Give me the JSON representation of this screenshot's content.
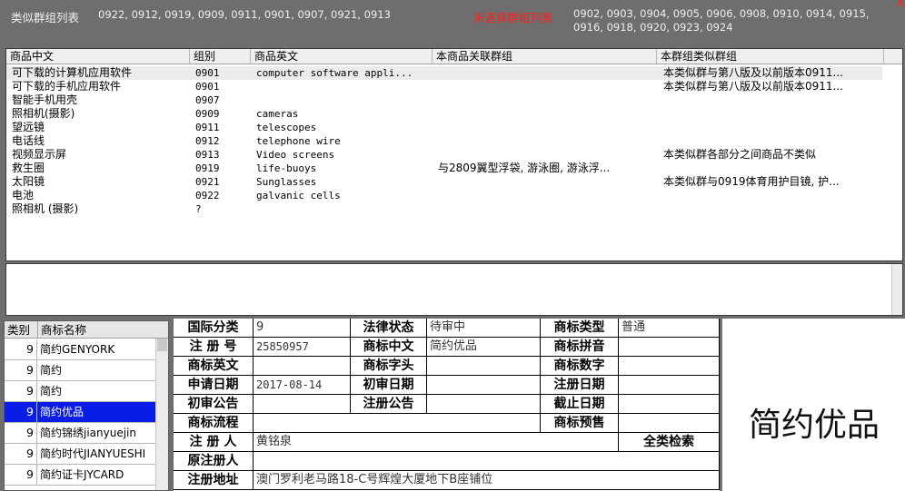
{
  "header": {
    "similar_groups_label": "类似群组列表",
    "similar_groups": "0922, 0912, 0919, 0909, 0911, 0901, 0907, 0921, 0913",
    "unselected_groups_label": "未选择群组列表",
    "unselected_groups": "0902, 0903, 0904, 0905, 0906, 0908, 0910, 0914, 0915, 0916, 0918, 0920, 0923, 0924",
    "close_glyph": "X"
  },
  "product_list": {
    "columns": [
      "商品中文",
      "组别",
      "商品英文",
      "本商品关联群组",
      "本群组类似群组"
    ],
    "rows": [
      {
        "cn": "可下载的计算机应用软件",
        "group": "0901",
        "en": "computer software appli...",
        "related": "",
        "similar": "本类似群与第八版及以前版本0911..."
      },
      {
        "cn": "可下载的手机应用软件",
        "group": "0901",
        "en": "",
        "related": "",
        "similar": "本类似群与第八版及以前版本0911..."
      },
      {
        "cn": "智能手机用壳",
        "group": "0907",
        "en": "",
        "related": "",
        "similar": ""
      },
      {
        "cn": "照相机(摄影)",
        "group": "0909",
        "en": "cameras",
        "related": "",
        "similar": ""
      },
      {
        "cn": "望远镜",
        "group": "0911",
        "en": "telescopes",
        "related": "",
        "similar": ""
      },
      {
        "cn": "电话线",
        "group": "0912",
        "en": "telephone wire",
        "related": "",
        "similar": ""
      },
      {
        "cn": "视频显示屏",
        "group": "0913",
        "en": "Video screens",
        "related": "",
        "similar": "本类似群各部分之间商品不类似"
      },
      {
        "cn": "救生圈",
        "group": "0919",
        "en": "life-buoys",
        "related": "与2809翼型浮袋, 游泳圈, 游泳浮...",
        "similar": ""
      },
      {
        "cn": "太阳镜",
        "group": "0921",
        "en": "Sunglasses",
        "related": "",
        "similar": "本类似群与0919体育用护目镜, 护..."
      },
      {
        "cn": "电池",
        "group": "0922",
        "en": "galvanic cells",
        "related": "",
        "similar": ""
      },
      {
        "cn": "照相机 (摄影)",
        "group": "?",
        "en": "",
        "related": "",
        "similar": ""
      }
    ]
  },
  "trademark_list": {
    "columns": [
      "类别",
      "商标名称"
    ],
    "rows": [
      {
        "cls": "9",
        "name": "简约GENYORK"
      },
      {
        "cls": "9",
        "name": "简约"
      },
      {
        "cls": "9",
        "name": "简约"
      },
      {
        "cls": "9",
        "name": "简约优品"
      },
      {
        "cls": "9",
        "name": "简约锦绣jianyuejin"
      },
      {
        "cls": "9",
        "name": "简约时代JIANYUESHI"
      },
      {
        "cls": "9",
        "name": "简约证卡JYCARD"
      }
    ],
    "selected_index": 3
  },
  "detail": {
    "intl_class_label": "国际分类",
    "intl_class": "9",
    "legal_status_label": "法律状态",
    "legal_status": "待审中",
    "tm_type_label": "商标类型",
    "tm_type": "普通",
    "reg_no_label": "注 册 号",
    "reg_no": "25850957",
    "tm_cn_label": "商标中文",
    "tm_cn": "简约优品",
    "tm_pinyin_label": "商标拼音",
    "tm_pinyin": "",
    "tm_en_label": "商标英文",
    "tm_en": "",
    "tm_initial_label": "商标字头",
    "tm_initial": "",
    "tm_number_label": "商标数字",
    "tm_number": "",
    "apply_date_label": "申请日期",
    "apply_date": "2017-08-14",
    "prelim_date_label": "初审日期",
    "prelim_date": "",
    "reg_date_label": "注册日期",
    "reg_date": "",
    "prelim_notice_label": "初审公告",
    "prelim_notice": "",
    "reg_notice_label": "注册公告",
    "reg_notice": "",
    "expire_date_label": "截止日期",
    "expire_date": "",
    "process_label": "商标流程",
    "process": "",
    "forecast_label": "商标预售",
    "forecast": "",
    "registrant_label": "注 册 人",
    "registrant": "黄铭泉",
    "full_search_label": "全类检索",
    "orig_registrant_label": "原注册人",
    "orig_registrant": "",
    "address_label": "注册地址",
    "address": "澳门罗利老马路18-C号辉煌大厦地下B座铺位"
  },
  "image_box": {
    "text": "简约优品"
  }
}
